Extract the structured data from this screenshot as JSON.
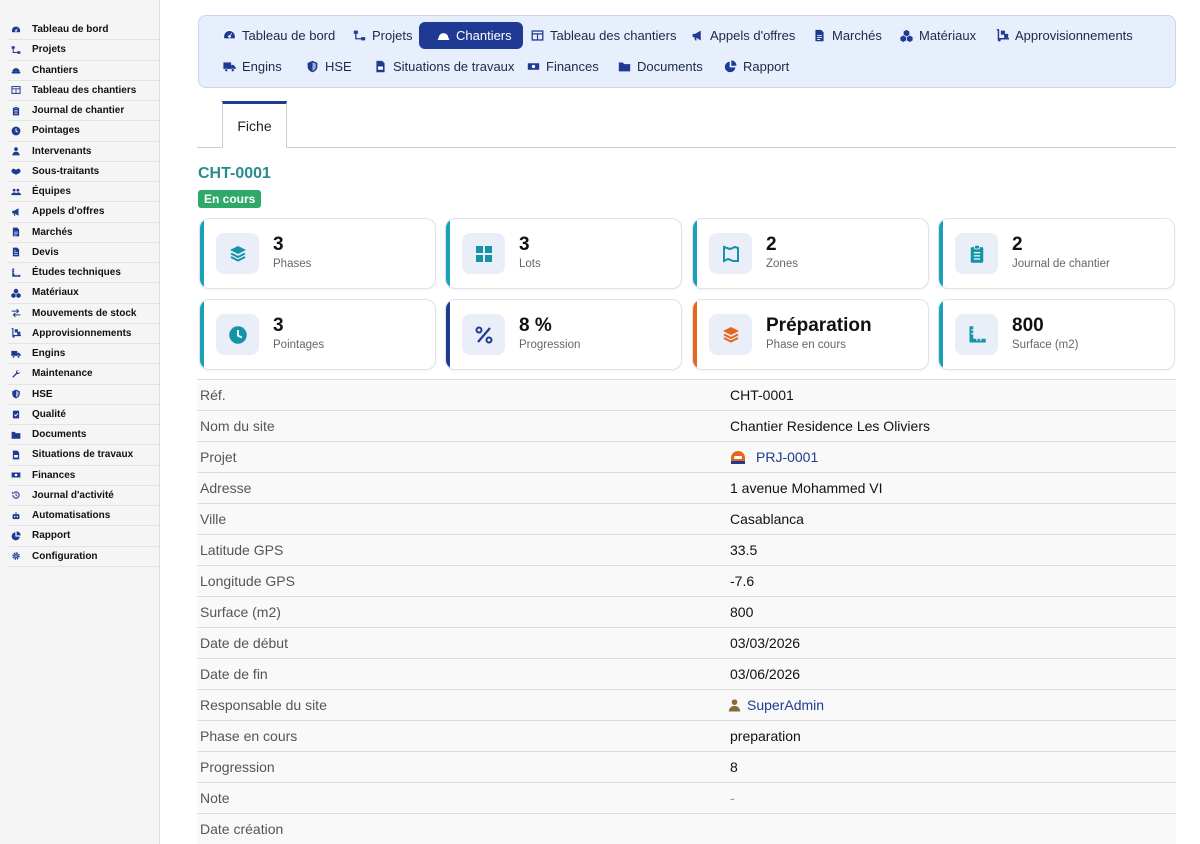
{
  "sidebar": {
    "items": [
      {
        "label": "Tableau de bord",
        "icon": "dashboard-icon"
      },
      {
        "label": "Projets",
        "icon": "sitemap-icon"
      },
      {
        "label": "Chantiers",
        "icon": "hardhat-icon"
      },
      {
        "label": "Tableau des chantiers",
        "icon": "table-icon"
      },
      {
        "label": "Journal de chantier",
        "icon": "clipboard-icon"
      },
      {
        "label": "Pointages",
        "icon": "clock-icon"
      },
      {
        "label": "Intervenants",
        "icon": "worker-icon"
      },
      {
        "label": "Sous-traitants",
        "icon": "handshake-icon"
      },
      {
        "label": "Équipes",
        "icon": "users-icon"
      },
      {
        "label": "Appels d'offres",
        "icon": "bullhorn-icon"
      },
      {
        "label": "Marchés",
        "icon": "contract-icon"
      },
      {
        "label": "Devis",
        "icon": "invoice-icon"
      },
      {
        "label": "Études techniques",
        "icon": "ruler-icon"
      },
      {
        "label": "Matériaux",
        "icon": "cubes-icon"
      },
      {
        "label": "Mouvements de stock",
        "icon": "exchange-icon"
      },
      {
        "label": "Approvisionnements",
        "icon": "dolly-icon"
      },
      {
        "label": "Engins",
        "icon": "truck-icon"
      },
      {
        "label": "Maintenance",
        "icon": "wrench-icon"
      },
      {
        "label": "HSE",
        "icon": "shield-icon"
      },
      {
        "label": "Qualité",
        "icon": "clipboard-check-icon"
      },
      {
        "label": "Documents",
        "icon": "folder-icon"
      },
      {
        "label": "Situations de travaux",
        "icon": "file-invoice-icon"
      },
      {
        "label": "Finances",
        "icon": "money-icon"
      },
      {
        "label": "Journal d'activité",
        "icon": "history-icon"
      },
      {
        "label": "Automatisations",
        "icon": "robot-icon"
      },
      {
        "label": "Rapport",
        "icon": "chart-pie-icon"
      },
      {
        "label": "Configuration",
        "icon": "gear-icon"
      }
    ]
  },
  "topnav": {
    "items": [
      {
        "label": "Tableau de bord",
        "icon": "dashboard-icon",
        "active": false
      },
      {
        "label": "Projets",
        "icon": "sitemap-icon",
        "active": false
      },
      {
        "label": "Chantiers",
        "icon": "hardhat-icon",
        "active": true
      },
      {
        "label": "Tableau des chantiers",
        "icon": "table-icon",
        "active": false
      },
      {
        "label": "Appels d'offres",
        "icon": "bullhorn-icon",
        "active": false
      },
      {
        "label": "Marchés",
        "icon": "contract-icon",
        "active": false
      },
      {
        "label": "Matériaux",
        "icon": "cubes-icon",
        "active": false
      },
      {
        "label": "Approvisionnements",
        "icon": "dolly-icon",
        "active": false
      },
      {
        "label": "Engins",
        "icon": "truck-icon",
        "active": false
      },
      {
        "label": "HSE",
        "icon": "shield-icon",
        "active": false
      },
      {
        "label": "Situations de travaux",
        "icon": "file-invoice-icon",
        "active": false
      },
      {
        "label": "Finances",
        "icon": "money-icon",
        "active": false
      },
      {
        "label": "Documents",
        "icon": "folder-icon",
        "active": false
      },
      {
        "label": "Rapport",
        "icon": "chart-pie-icon",
        "active": false
      }
    ]
  },
  "tabs": {
    "fiche": "Fiche"
  },
  "header": {
    "ref": "CHT-0001",
    "status": "En cours"
  },
  "colors": {
    "primary": "#1f3a93",
    "teal": "#2a8b8f",
    "success": "#2fa86a",
    "orange": "#e8651a",
    "card_teal": "#1ba1b5",
    "card_navy": "#1f3a93"
  },
  "cards": [
    {
      "value": "3",
      "label": "Phases",
      "icon": "layers-icon",
      "accent": "#1ba1b5"
    },
    {
      "value": "3",
      "label": "Lots",
      "icon": "grid-icon",
      "accent": "#1ba1b5"
    },
    {
      "value": "2",
      "label": "Zones",
      "icon": "map-icon",
      "accent": "#1ba1b5"
    },
    {
      "value": "2",
      "label": "Journal de chantier",
      "icon": "clipboard-icon",
      "accent": "#1ba1b5"
    },
    {
      "value": "3",
      "label": "Pointages",
      "icon": "clock-icon",
      "accent": "#1ba1b5"
    },
    {
      "value": "8 %",
      "label": "Progression",
      "icon": "percent-icon",
      "accent": "#1f3a93"
    },
    {
      "value": "Préparation",
      "label": "Phase en cours",
      "icon": "layers-icon",
      "accent": "#e8651a"
    },
    {
      "value": "800",
      "label": "Surface (m2)",
      "icon": "ruler-icon",
      "accent": "#1ba1b5"
    }
  ],
  "details": [
    {
      "label": "Réf.",
      "value": "CHT-0001",
      "kind": "text"
    },
    {
      "label": "Nom du site",
      "value": "Chantier Residence Les Oliviers",
      "kind": "text"
    },
    {
      "label": "Projet",
      "value": "PRJ-0001",
      "kind": "project-link"
    },
    {
      "label": "Adresse",
      "value": "1 avenue Mohammed VI",
      "kind": "text"
    },
    {
      "label": "Ville",
      "value": "Casablanca",
      "kind": "text"
    },
    {
      "label": "Latitude GPS",
      "value": "33.5",
      "kind": "text"
    },
    {
      "label": "Longitude GPS",
      "value": "-7.6",
      "kind": "text"
    },
    {
      "label": "Surface (m2)",
      "value": "800",
      "kind": "text"
    },
    {
      "label": "Date de début",
      "value": "03/03/2026",
      "kind": "text"
    },
    {
      "label": "Date de fin",
      "value": "03/06/2026",
      "kind": "text"
    },
    {
      "label": "Responsable du site",
      "value": "SuperAdmin",
      "kind": "user-link"
    },
    {
      "label": "Phase en cours",
      "value": "preparation",
      "kind": "text"
    },
    {
      "label": "Progression",
      "value": "8",
      "kind": "text"
    },
    {
      "label": "Note",
      "value": "-",
      "kind": "muted"
    },
    {
      "label": "Date création",
      "value": "",
      "kind": "text"
    }
  ]
}
